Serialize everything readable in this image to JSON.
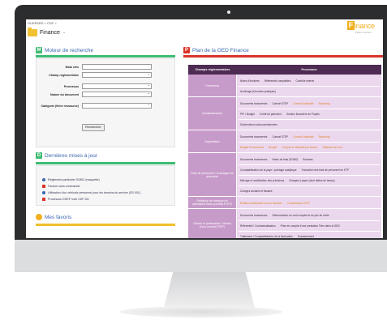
{
  "breadcrumb": "GUEPARD  >  CDF  >",
  "page_title": "Finance",
  "page_title_chevron": "⌄",
  "logo": {
    "initial": "F",
    "name": "inance",
    "tagline": "Filière Finance"
  },
  "search": {
    "title": "Moteur de recherche",
    "icon_letter": "M",
    "fields": [
      {
        "label": "Mots clés",
        "type": "text",
        "value": ""
      },
      {
        "label": "Champ réglementaire",
        "type": "select",
        "value": ""
      },
      {
        "label": "Processus",
        "type": "select",
        "value": ""
      },
      {
        "label": "Nature du document",
        "type": "select",
        "value": ""
      },
      {
        "label": "Catégorie (fiche ressource)",
        "type": "select",
        "value": ""
      }
    ],
    "button": "Rechercher"
  },
  "updates": {
    "title": "Dernières mises à jour",
    "icon_letter": "D",
    "items": [
      "Règlement particulier SOBO (maquette)",
      "Facture sans commande",
      "Utilisation d'un véhicule personnel pour les besoins du service (SS 001)",
      "Processus OGEP note CDF DD"
    ]
  },
  "favorites": {
    "title": "Mes favoris"
  },
  "ged": {
    "title": "Plan de la GED Finance",
    "icon_letter": "P",
    "col1": "Champs réglementaires",
    "col2": "Processus",
    "rows": [
      {
        "label": "Transverse",
        "subs": [
          [
            "Notes d'écritures",
            "Référentiel comptables",
            "Contrôle interne"
          ],
          [
            "Archivage (Données pratiques)"
          ]
        ]
      },
      {
        "label": "Investissements",
        "subs": [
          [
            "Documents transverses",
            "Contrat STEP",
            "Contrat d'objectifs",
            "Reporting"
          ],
          [
            "PPI / Budget",
            "Crédit de paiement",
            "Gestion financière de Projets"
          ],
          [
            "Subventions subconventionnées"
          ]
        ]
      },
      {
        "label": "Exploitation",
        "subs": [
          [
            "Documents transverses",
            "Contrat STEP",
            "Contrat d'objectifs",
            "Reporting"
          ],
          [
            "Budget Performance",
            "Budget",
            "Compte de Résultat par Nature",
            "Tableaux de bord"
          ]
        ]
      },
      {
        "label": "Frais de personnel / Avantages au personnel",
        "subs": [
          [
            "Documents transverses",
            "Notes de frais (SOBO)",
            "Bonimes"
          ],
          [
            "Comptabilisation de la paye / pointage analytique",
            "Traduction des frais de personnel en ETP"
          ],
          [
            "Ménage et modification des prévisions",
            "Charges à payer (dont dettes de temps)"
          ],
          [
            "Charges sociales et fiscales"
          ]
        ]
      },
      {
        "label": "Relations de transport et opérations Bass (contrat STEP)",
        "subs": [
          [
            "Relation Individuelle sur les mesures",
            "Contributions STEP"
          ]
        ]
      },
      {
        "label": "Clients et partenaires / Ventes (hors contrat STEP)",
        "subs": [
          [
            "Documents transverses",
            "Détermination du coût complet et du prix de vente"
          ],
          [
            "Référentiel / Contractualisation",
            "Prise en compte d'une prestation Tiers dans la GED"
          ],
          [
            "Traitement / Comptabilisation de la facturation",
            "Encaissement"
          ]
        ]
      }
    ]
  },
  "colors": {
    "green": "#3dbb72",
    "purple_head": "#4d2b53",
    "purple_cell": "#c79bc9",
    "lilac": "#ecd8ee",
    "orange": "#f0b020",
    "red_bar": "#d9352a"
  }
}
